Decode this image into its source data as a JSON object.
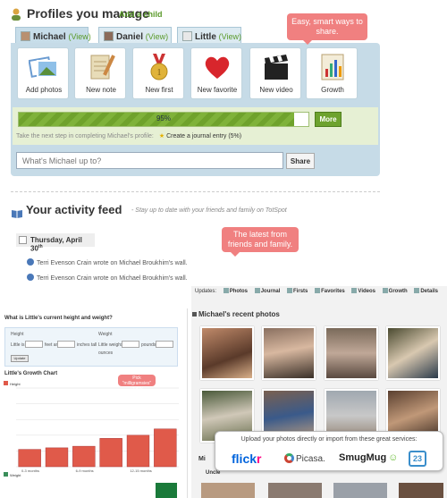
{
  "header": {
    "title": "Profiles you manage",
    "add_child": "Add a child"
  },
  "tabs": [
    {
      "name": "Michael",
      "view": "(View)"
    },
    {
      "name": "Daniel",
      "view": "(View)"
    },
    {
      "name": "Little",
      "view": "(View)"
    }
  ],
  "actions": [
    {
      "label": "Add photos",
      "icon": "photos-icon"
    },
    {
      "label": "New note",
      "icon": "note-icon"
    },
    {
      "label": "New first",
      "icon": "medal-icon"
    },
    {
      "label": "New favorite",
      "icon": "heart-icon"
    },
    {
      "label": "New video",
      "icon": "clapper-icon"
    },
    {
      "label": "Growth",
      "icon": "chart-icon"
    }
  ],
  "callouts": {
    "share": "Easy, smart ways to share.",
    "feed": "The latest from friends and family."
  },
  "progress": {
    "value": 0.95,
    "label": "95%",
    "more": "More"
  },
  "next_step": {
    "text": "Take the next step in completing Michael's profile:",
    "link": "Create a journal entry (5%)"
  },
  "status": {
    "placeholder": "What's Michael up to?",
    "share": "Share"
  },
  "feed": {
    "title": "Your activity feed",
    "subtitle": "- Stay up to date with your friends and family on TotSpot",
    "date": "Thursday, April 30",
    "date_sup": "th",
    "items": [
      "Terri Evenson Crain wrote on Michael Broukhim's wall.",
      "Terri Evenson Crain wrote on Michael Broukhim's wall."
    ]
  },
  "growth": {
    "question": "What is Little's current height and weight?",
    "height_label": "Height",
    "weight_label": "Weight",
    "height_row": [
      "Little is",
      "feet and",
      "inches tall"
    ],
    "weight_row": [
      "Little weighs",
      "pounds and",
      "ounces"
    ],
    "update": "Update",
    "chart_title": "Little's Growth Chart",
    "note": "Pick \"milligramsies\" charts",
    "legend": [
      "Height",
      "Weight"
    ]
  },
  "chart_data": {
    "type": "bar",
    "title": "Little's Growth Chart",
    "categories": [
      "1",
      "2",
      "3",
      "4",
      "5",
      "6"
    ],
    "values": [
      22,
      24,
      26,
      36,
      40,
      48
    ],
    "x_tick_labels": [
      "0-3 months",
      "6-9 months",
      "12-15 months"
    ],
    "ylim": [
      0,
      100
    ]
  },
  "photos": {
    "toolbar": [
      "Photos",
      "Journal",
      "Firsts",
      "Favorites",
      "Videos",
      "Growth",
      "Details"
    ],
    "toolbar_label": "Updates:",
    "title": "Michael's recent photos",
    "mi_label": "Mi",
    "unc_label": "Uncle"
  },
  "services": {
    "title": "Upload your photos directly or import from these great services:",
    "flickr_a": "flick",
    "flickr_b": "r",
    "picasa": "Picasa.",
    "smugmug": "SmugMug",
    "calendar": "23"
  },
  "colors": {
    "accent_green": "#6da22e",
    "panel_blue": "#c6dbe7",
    "callout": "#f08080",
    "bar_red": "#e05a4a"
  }
}
